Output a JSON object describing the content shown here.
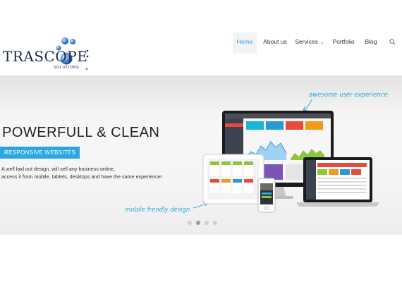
{
  "brand": {
    "name": "TRASCOPE",
    "tagline": "SOLUTIONS"
  },
  "nav": {
    "items": [
      {
        "label": "Home",
        "active": true
      },
      {
        "label": "About us",
        "active": false
      },
      {
        "label": "Services",
        "active": false,
        "has_dropdown": true
      },
      {
        "label": "Portfolio",
        "active": false
      },
      {
        "label": "Blog",
        "active": false
      }
    ],
    "search_icon": "search-icon"
  },
  "hero": {
    "headline": "POWERFULL & CLEAN",
    "badge": "RESPONSIVE WEBSITES",
    "description_line1": "A well laid out design, will sell any business online,",
    "description_line2": "access it from mobile, tablets, desktops and have the same experience!",
    "annotation_top": "awesome user experience",
    "annotation_bottom": "mobile frendly design",
    "slides": {
      "count": 4,
      "active_index": 1
    }
  },
  "colors": {
    "accent": "#2aa7e0",
    "text_dark": "#222222",
    "logo_dark": "#1a2a4a"
  }
}
